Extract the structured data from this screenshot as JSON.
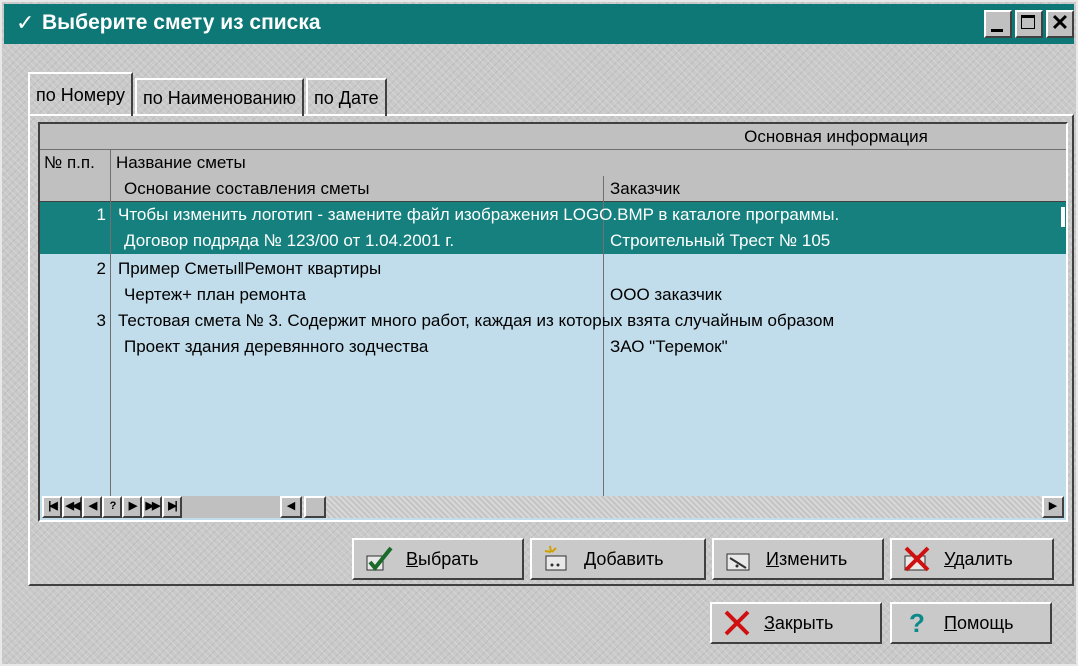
{
  "window": {
    "title": "Выберите смету из списка",
    "title_icon": "checkmark-icon",
    "controls": [
      "minimize",
      "maximize",
      "close"
    ],
    "close_glyph": "✕"
  },
  "tabs": [
    {
      "label": "по Номеру",
      "active": true
    },
    {
      "label": "по Наименованию",
      "active": false
    },
    {
      "label": "по Дате",
      "active": false
    }
  ],
  "grid": {
    "group_header": "Основная информация",
    "headers": {
      "num": "№ п.п.",
      "name": "Название сметы",
      "basis": "Основание составления сметы",
      "customer": "Заказчик"
    },
    "rows": [
      {
        "num": "1",
        "name": "Чтобы изменить логотип - замените файл изображения LOGO.BMP в каталоге программы.",
        "basis": "Договор подряда № 123/00 от 1.04.2001 г.",
        "customer": "Строительный Трест № 105",
        "selected": true
      },
      {
        "num": "2",
        "name": "Пример Сметы‖Ремонт квартиры",
        "basis": "Чертеж+ план ремонта",
        "customer": "ООО заказчик",
        "selected": false
      },
      {
        "num": "3",
        "name": "Тестовая смета № 3. Содержит много работ, каждая из которых взята случайным образом",
        "basis": "Проект здания деревянного зодчества",
        "customer": "ЗАО \"Теремок\"",
        "selected": false
      }
    ],
    "navigator": [
      "|◀",
      "◀◀",
      "◀",
      "?",
      "▶",
      "▶▶",
      "▶|"
    ]
  },
  "buttons": {
    "select": "Выбрать",
    "add": "Добавить",
    "edit": "Изменить",
    "delete": "Удалить",
    "close": "Закрыть",
    "help": "Помощь"
  },
  "colors": {
    "titlebar": "#0e7876",
    "selection": "#15807e",
    "grid_bg": "#c1dcea"
  }
}
